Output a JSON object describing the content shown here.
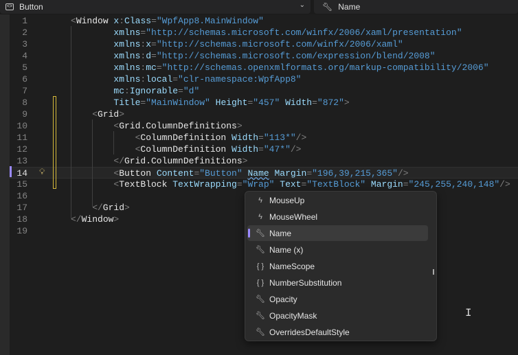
{
  "header": {
    "element_dropdown": "Button",
    "member_dropdown": "Name"
  },
  "code_lines": [
    {
      "n": "1",
      "indent": 0,
      "tokens": [
        [
          "p",
          "<"
        ],
        [
          "e",
          "Window"
        ],
        [
          "a",
          " x"
        ],
        [
          "p",
          ":"
        ],
        [
          "a",
          "Class"
        ],
        [
          "p",
          "="
        ],
        [
          "s",
          "\"WpfApp8.MainWindow\""
        ]
      ]
    },
    {
      "n": "2",
      "indent": 8,
      "tokens": [
        [
          "a",
          "xmlns"
        ],
        [
          "p",
          "="
        ],
        [
          "s",
          "\"http://schemas.microsoft.com/winfx/2006/xaml/presentation\""
        ]
      ]
    },
    {
      "n": "3",
      "indent": 8,
      "tokens": [
        [
          "a",
          "xmlns"
        ],
        [
          "p",
          ":"
        ],
        [
          "a",
          "x"
        ],
        [
          "p",
          "="
        ],
        [
          "s",
          "\"http://schemas.microsoft.com/winfx/2006/xaml\""
        ]
      ]
    },
    {
      "n": "4",
      "indent": 8,
      "tokens": [
        [
          "a",
          "xmlns"
        ],
        [
          "p",
          ":"
        ],
        [
          "a",
          "d"
        ],
        [
          "p",
          "="
        ],
        [
          "s",
          "\"http://schemas.microsoft.com/expression/blend/2008\""
        ]
      ]
    },
    {
      "n": "5",
      "indent": 8,
      "tokens": [
        [
          "a",
          "xmlns"
        ],
        [
          "p",
          ":"
        ],
        [
          "a",
          "mc"
        ],
        [
          "p",
          "="
        ],
        [
          "s",
          "\"http://schemas.openxmlformats.org/markup-compatibility/2006\""
        ]
      ]
    },
    {
      "n": "6",
      "indent": 8,
      "tokens": [
        [
          "a",
          "xmlns"
        ],
        [
          "p",
          ":"
        ],
        [
          "a",
          "local"
        ],
        [
          "p",
          "="
        ],
        [
          "s",
          "\"clr-namespace:WpfApp8\""
        ]
      ]
    },
    {
      "n": "7",
      "indent": 8,
      "tokens": [
        [
          "a",
          "mc"
        ],
        [
          "p",
          ":"
        ],
        [
          "a",
          "Ignorable"
        ],
        [
          "p",
          "="
        ],
        [
          "s",
          "\"d\""
        ]
      ]
    },
    {
      "n": "8",
      "indent": 8,
      "tokens": [
        [
          "a",
          "Title"
        ],
        [
          "p",
          "="
        ],
        [
          "s",
          "\"MainWindow\""
        ],
        [
          "a",
          " Height"
        ],
        [
          "p",
          "="
        ],
        [
          "s",
          "\"457\""
        ],
        [
          "a",
          " Width"
        ],
        [
          "p",
          "="
        ],
        [
          "s",
          "\"872\""
        ],
        [
          "p",
          ">"
        ]
      ]
    },
    {
      "n": "9",
      "indent": 4,
      "tokens": [
        [
          "p",
          "<"
        ],
        [
          "e",
          "Grid"
        ],
        [
          "p",
          ">"
        ]
      ]
    },
    {
      "n": "10",
      "indent": 8,
      "tokens": [
        [
          "p",
          "<"
        ],
        [
          "e",
          "Grid.ColumnDefinitions"
        ],
        [
          "p",
          ">"
        ]
      ]
    },
    {
      "n": "11",
      "indent": 12,
      "tokens": [
        [
          "p",
          "<"
        ],
        [
          "e",
          "ColumnDefinition"
        ],
        [
          "a",
          " Width"
        ],
        [
          "p",
          "="
        ],
        [
          "s",
          "\"113*\""
        ],
        [
          "p",
          "/>"
        ]
      ]
    },
    {
      "n": "12",
      "indent": 12,
      "tokens": [
        [
          "p",
          "<"
        ],
        [
          "e",
          "ColumnDefinition"
        ],
        [
          "a",
          " Width"
        ],
        [
          "p",
          "="
        ],
        [
          "s",
          "\"47*\""
        ],
        [
          "p",
          "/>"
        ]
      ]
    },
    {
      "n": "13",
      "indent": 8,
      "tokens": [
        [
          "p",
          "</"
        ],
        [
          "e",
          "Grid.ColumnDefinitions"
        ],
        [
          "p",
          ">"
        ]
      ]
    },
    {
      "n": "14",
      "indent": 8,
      "tokens": [
        [
          "p",
          "<"
        ],
        [
          "e",
          "Button"
        ],
        [
          "a",
          " Content"
        ],
        [
          "p",
          "="
        ],
        [
          "s",
          "\"Button\""
        ],
        [
          "a",
          " "
        ],
        [
          "sq",
          "Name"
        ],
        [
          "a",
          " Margin"
        ],
        [
          "p",
          "="
        ],
        [
          "s",
          "\"196,39,215,365\""
        ],
        [
          "p",
          "/>"
        ]
      ]
    },
    {
      "n": "15",
      "indent": 8,
      "tokens": [
        [
          "p",
          "<"
        ],
        [
          "e",
          "TextBlock"
        ],
        [
          "a",
          " TextWrapping"
        ],
        [
          "p",
          "="
        ],
        [
          "s",
          "\"Wrap\""
        ],
        [
          "a",
          " Text"
        ],
        [
          "p",
          "="
        ],
        [
          "s",
          "\"TextBlock\""
        ],
        [
          "a",
          " Margin"
        ],
        [
          "p",
          "="
        ],
        [
          "s",
          "\"245,255,240,148\""
        ],
        [
          "p",
          "/>"
        ]
      ]
    },
    {
      "n": "16",
      "indent": 0,
      "tokens": []
    },
    {
      "n": "17",
      "indent": 4,
      "tokens": [
        [
          "p",
          "</"
        ],
        [
          "e",
          "Grid"
        ],
        [
          "p",
          ">"
        ]
      ]
    },
    {
      "n": "18",
      "indent": 0,
      "tokens": [
        [
          "p",
          "</"
        ],
        [
          "e",
          "Window"
        ],
        [
          "p",
          ">"
        ]
      ]
    },
    {
      "n": "19",
      "indent": 0,
      "tokens": []
    }
  ],
  "current_line": "14",
  "completion": {
    "items": [
      {
        "label": "MouseUp",
        "icon": "event-icon"
      },
      {
        "label": "MouseWheel",
        "icon": "event-icon"
      },
      {
        "label": "Name",
        "icon": "property-icon",
        "selected": true
      },
      {
        "label": "Name (x)",
        "icon": "property-icon"
      },
      {
        "label": "NameScope",
        "icon": "braces-icon"
      },
      {
        "label": "NumberSubstitution",
        "icon": "braces-icon"
      },
      {
        "label": "Opacity",
        "icon": "property-icon"
      },
      {
        "label": "OpacityMask",
        "icon": "property-icon"
      },
      {
        "label": "OverridesDefaultStyle",
        "icon": "property-icon"
      }
    ]
  }
}
